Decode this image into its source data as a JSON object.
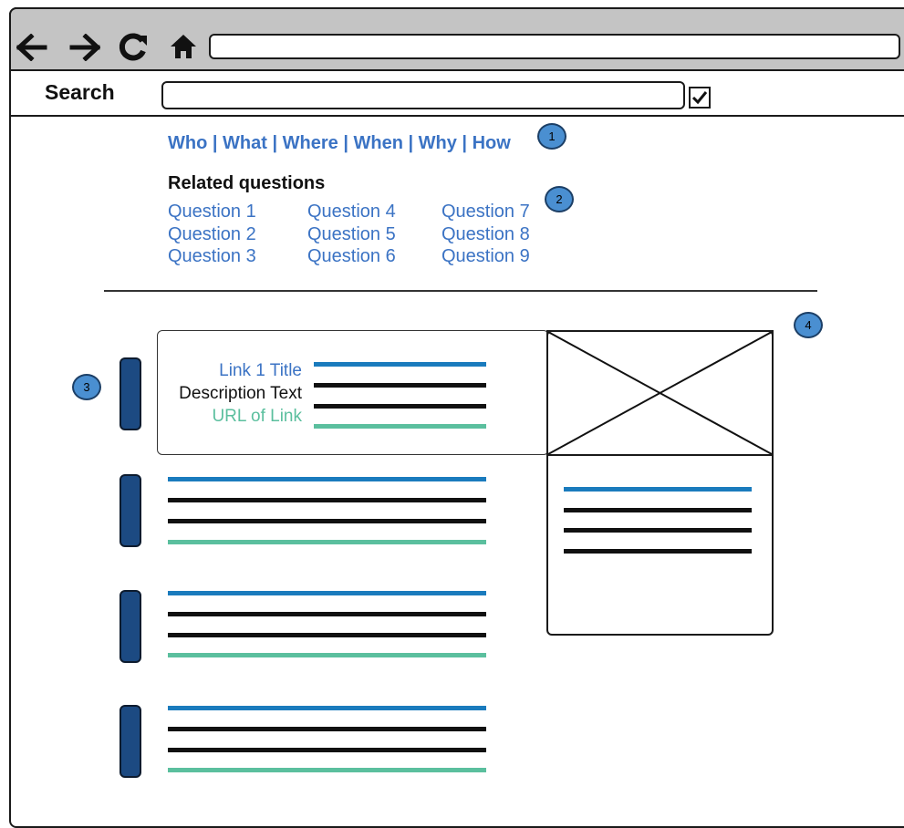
{
  "browser": {
    "nav_icons": [
      "back-arrow-icon",
      "forward-arrow-icon",
      "reload-icon",
      "home-icon"
    ],
    "url_value": ""
  },
  "search": {
    "label": "Search",
    "value": "",
    "checkbox_checked": true
  },
  "wh_links": [
    "Who",
    "What",
    "Where",
    "When",
    "Why",
    "How"
  ],
  "wh_separator": " | ",
  "badges": [
    "1",
    "2",
    "3",
    "4"
  ],
  "related": {
    "title": "Related questions",
    "questions": [
      "Question 1",
      "Question 2",
      "Question 3",
      "Question 4",
      "Question 5",
      "Question 6",
      "Question 7",
      "Question 8",
      "Question 9"
    ]
  },
  "results": [
    {
      "title": "Link 1 Title",
      "description": "Description Text",
      "url": "URL of Link"
    }
  ],
  "colors": {
    "link_blue": "#3b73c4",
    "title_line": "#1a7bbd",
    "url_teal": "#5bbf9e",
    "pill_navy": "#1c4a82",
    "badge_blue": "#4a8fd1",
    "chrome_gray": "#c4c4c4"
  }
}
